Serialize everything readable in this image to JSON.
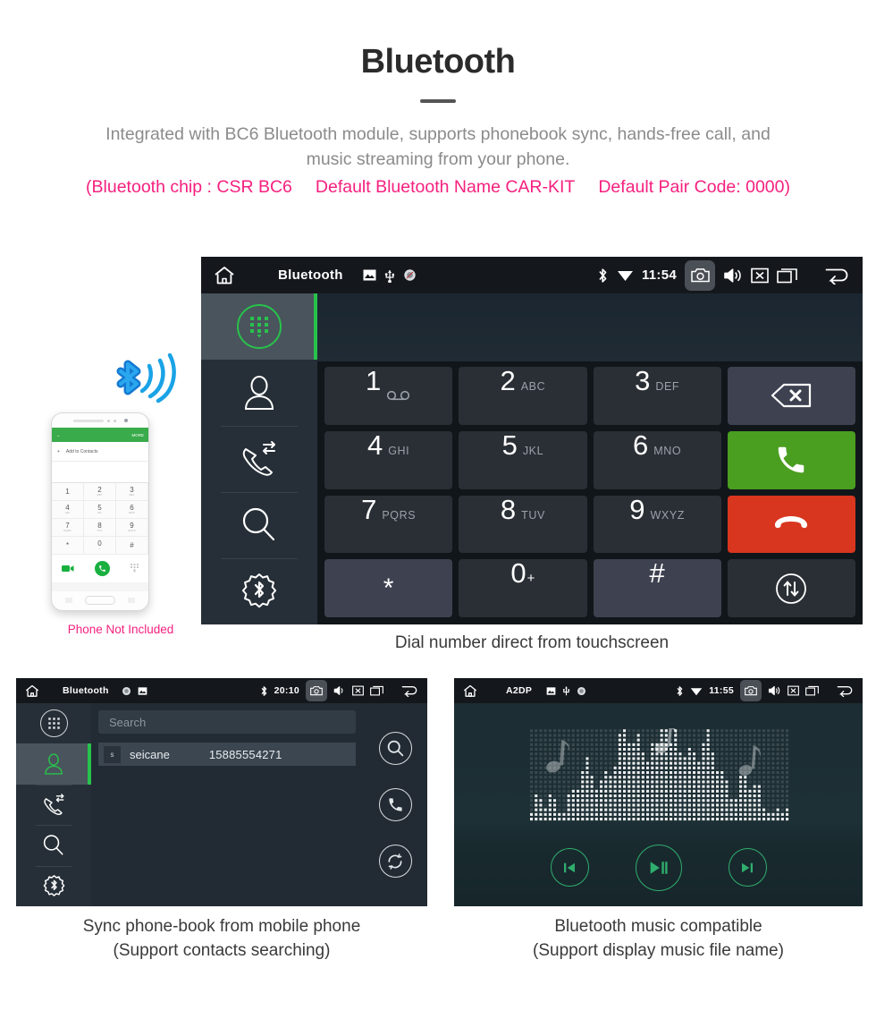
{
  "header": {
    "title": "Bluetooth",
    "subtitle_line1": "Integrated with BC6 Bluetooth module, supports phonebook sync, hands-free call, and",
    "subtitle_line2": "music streaming from your phone.",
    "spec_open": "(Bluetooth chip : CSR BC6",
    "spec_name": "Default Bluetooth Name CAR-KIT",
    "spec_pair": "Default Pair Code: 0000)",
    "accent_pink": "#f5207f",
    "title_color": "#2b2b2b",
    "subtitle_color": "#8b8b8b"
  },
  "phone_mockup": {
    "note": "Phone Not Included",
    "app_bar_more": "MORE",
    "add_contacts": "Add to Contacts",
    "keys": [
      {
        "digit": "1",
        "letters": ""
      },
      {
        "digit": "2",
        "letters": "ABC"
      },
      {
        "digit": "3",
        "letters": "DEF"
      },
      {
        "digit": "4",
        "letters": "GHI"
      },
      {
        "digit": "5",
        "letters": "JKL"
      },
      {
        "digit": "6",
        "letters": "MNO"
      },
      {
        "digit": "7",
        "letters": "PQRS"
      },
      {
        "digit": "8",
        "letters": "TUV"
      },
      {
        "digit": "9",
        "letters": "WXYZ"
      },
      {
        "digit": "*",
        "letters": ""
      },
      {
        "digit": "0",
        "letters": "+"
      },
      {
        "digit": "#",
        "letters": ""
      }
    ]
  },
  "dialer_screen": {
    "statusbar": {
      "title": "Bluetooth",
      "time": "11:54",
      "left_icons": [
        "home-icon",
        "sdcard-icon",
        "usb-icon",
        "mute-icon"
      ],
      "right_icons": [
        "bluetooth-icon",
        "wifi-icon",
        "camera-icon",
        "volume-icon",
        "close-icon",
        "recents-icon",
        "back-icon"
      ]
    },
    "sidebar": [
      {
        "name": "dialpad",
        "label": "Dialpad",
        "active": true
      },
      {
        "name": "contacts",
        "label": "Contacts",
        "active": false
      },
      {
        "name": "call-history",
        "label": "Call History",
        "active": false
      },
      {
        "name": "search",
        "label": "Search",
        "active": false
      },
      {
        "name": "bt-settings",
        "label": "Bluetooth Settings",
        "active": false
      }
    ],
    "number_value": "",
    "keypad": [
      {
        "digit": "1",
        "letters": "",
        "kind": "num",
        "voicemail": true
      },
      {
        "digit": "2",
        "letters": "ABC",
        "kind": "num"
      },
      {
        "digit": "3",
        "letters": "DEF",
        "kind": "num"
      },
      {
        "digit": "",
        "letters": "",
        "kind": "delete",
        "icon": "backspace-icon"
      },
      {
        "digit": "4",
        "letters": "GHI",
        "kind": "num"
      },
      {
        "digit": "5",
        "letters": "JKL",
        "kind": "num"
      },
      {
        "digit": "6",
        "letters": "MNO",
        "kind": "num"
      },
      {
        "digit": "",
        "letters": "",
        "kind": "call",
        "icon": "call-icon"
      },
      {
        "digit": "7",
        "letters": "PQRS",
        "kind": "num"
      },
      {
        "digit": "8",
        "letters": "TUV",
        "kind": "num"
      },
      {
        "digit": "9",
        "letters": "WXYZ",
        "kind": "num"
      },
      {
        "digit": "",
        "letters": "",
        "kind": "hangup",
        "icon": "hangup-icon"
      },
      {
        "digit": "*",
        "letters": "",
        "kind": "sym"
      },
      {
        "digit": "0",
        "letters": "+",
        "kind": "num"
      },
      {
        "digit": "#",
        "letters": "",
        "kind": "sym"
      },
      {
        "digit": "",
        "letters": "",
        "kind": "swap",
        "icon": "transfer-audio-icon"
      }
    ],
    "caption": "Dial number direct from touchscreen"
  },
  "phonebook_screen": {
    "statusbar": {
      "title": "Bluetooth",
      "time": "20:10"
    },
    "search_placeholder": "Search",
    "contacts": [
      {
        "initial": "s",
        "name": "seicane",
        "number": "15885554271"
      }
    ],
    "actions": [
      "search-icon",
      "call-icon",
      "sync-icon"
    ],
    "caption_line1": "Sync phone-book from mobile phone",
    "caption_line2": "(Support contacts searching)"
  },
  "music_screen": {
    "statusbar": {
      "title": "A2DP",
      "time": "11:55"
    },
    "transport": [
      "previous-icon",
      "play-pause-icon",
      "next-icon"
    ],
    "caption_line1": "Bluetooth music compatible",
    "caption_line2": "(Support display music file name)"
  },
  "theme": {
    "green": "#27c24c",
    "call_green": "#4a9e20",
    "hangup_red": "#d8361f",
    "sidebar_bg": "#262f37",
    "statusbar_bg": "#14181d",
    "bluetooth_blue": "#1b9fe0"
  }
}
